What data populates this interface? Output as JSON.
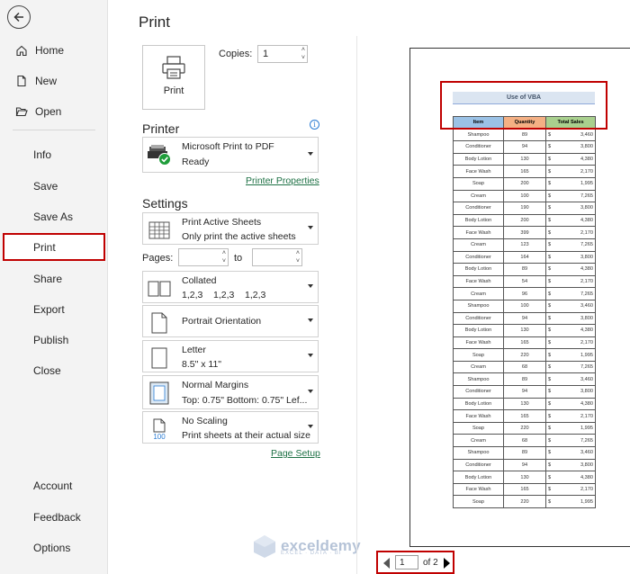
{
  "nav": {
    "items": [
      {
        "label": "Home"
      },
      {
        "label": "New"
      },
      {
        "label": "Open"
      },
      {
        "label": "Info"
      },
      {
        "label": "Save"
      },
      {
        "label": "Save As"
      },
      {
        "label": "Print"
      },
      {
        "label": "Share"
      },
      {
        "label": "Export"
      },
      {
        "label": "Publish"
      },
      {
        "label": "Close"
      },
      {
        "label": "Account"
      },
      {
        "label": "Feedback"
      },
      {
        "label": "Options"
      }
    ],
    "active": "Print"
  },
  "print": {
    "title": "Print",
    "button_label": "Print",
    "copies_label": "Copies:",
    "copies_value": "1"
  },
  "printer": {
    "heading": "Printer",
    "name": "Microsoft Print to PDF",
    "status": "Ready",
    "properties_link": "Printer Properties"
  },
  "settings": {
    "heading": "Settings",
    "scope": {
      "line1": "Print Active Sheets",
      "line2": "Only print the active sheets"
    },
    "pages_label": "Pages:",
    "to_label": "to",
    "collation": {
      "line1": "Collated",
      "line2": "1,2,3    1,2,3    1,2,3"
    },
    "orientation": "Portrait Orientation",
    "paper": {
      "line1": "Letter",
      "line2": "8.5\" x 11\""
    },
    "margins": {
      "line1": "Normal Margins",
      "line2": "Top: 0.75\" Bottom: 0.75\" Lef..."
    },
    "scaling": {
      "line1": "No Scaling",
      "line2": "Print sheets at their actual size",
      "icon_text": "100"
    },
    "page_setup_link": "Page Setup"
  },
  "preview": {
    "report_title": "Use of VBA",
    "headers": [
      "Item",
      "Quantity",
      "Total Sales"
    ],
    "currency": "$",
    "rows": [
      [
        "Shampoo",
        "89",
        "3,460"
      ],
      [
        "Conditioner",
        "94",
        "3,800"
      ],
      [
        "Body Lotion",
        "130",
        "4,380"
      ],
      [
        "Face Wash",
        "165",
        "2,170"
      ],
      [
        "Soap",
        "200",
        "1,995"
      ],
      [
        "Cream",
        "100",
        "7,265"
      ],
      [
        "Conditioner",
        "190",
        "3,800"
      ],
      [
        "Body Lotion",
        "200",
        "4,380"
      ],
      [
        "Face Wash",
        "399",
        "2,170"
      ],
      [
        "Cream",
        "123",
        "7,265"
      ],
      [
        "Conditioner",
        "164",
        "3,800"
      ],
      [
        "Body Lotion",
        "89",
        "4,380"
      ],
      [
        "Face Wash",
        "54",
        "2,170"
      ],
      [
        "Cream",
        "96",
        "7,265"
      ],
      [
        "Shampoo",
        "100",
        "3,460"
      ],
      [
        "Conditioner",
        "94",
        "3,800"
      ],
      [
        "Body Lotion",
        "130",
        "4,380"
      ],
      [
        "Face Wash",
        "165",
        "2,170"
      ],
      [
        "Soap",
        "220",
        "1,995"
      ],
      [
        "Cream",
        "68",
        "7,265"
      ],
      [
        "Shampoo",
        "89",
        "3,460"
      ],
      [
        "Conditioner",
        "94",
        "3,800"
      ],
      [
        "Body Lotion",
        "130",
        "4,380"
      ],
      [
        "Face Wash",
        "165",
        "2,170"
      ],
      [
        "Soap",
        "220",
        "1,995"
      ],
      [
        "Cream",
        "68",
        "7,265"
      ],
      [
        "Shampoo",
        "89",
        "3,460"
      ],
      [
        "Conditioner",
        "94",
        "3,800"
      ],
      [
        "Body Lotion",
        "130",
        "4,380"
      ],
      [
        "Face Wash",
        "165",
        "2,170"
      ],
      [
        "Soap",
        "220",
        "1,995"
      ]
    ]
  },
  "pager": {
    "current": "1",
    "of_label": "of 2"
  },
  "watermark": {
    "name": "exceldemy",
    "sub": "EXCEL · DATA · BI"
  },
  "colors": {
    "accent_red": "#c00000",
    "link_green": "#1e7145"
  }
}
